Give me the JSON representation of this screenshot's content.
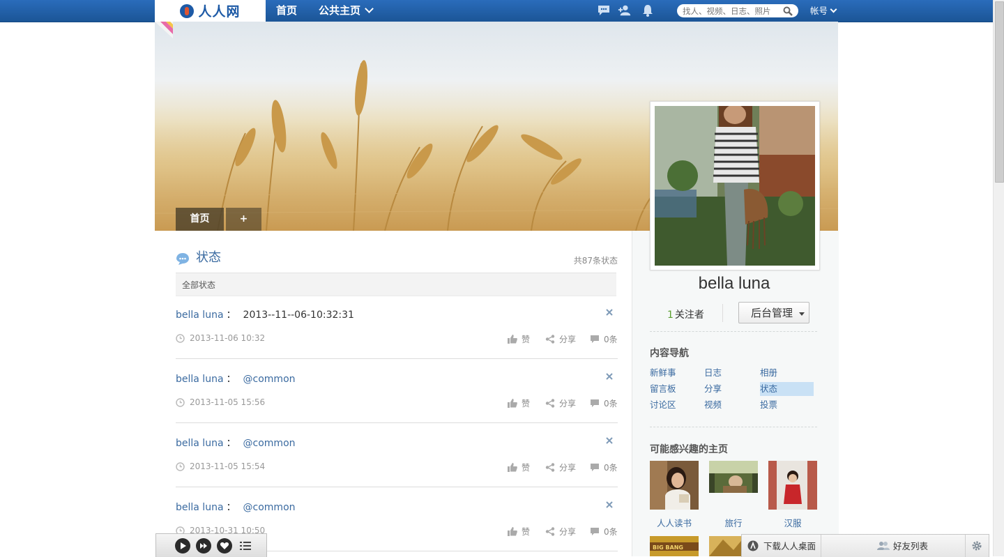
{
  "topbar": {
    "logo_text": "人人网",
    "nav_home": "首页",
    "nav_public": "公共主页",
    "search_placeholder": "找人、视频、日志、照片",
    "account_label": "帐号"
  },
  "cover": {
    "tabs": [
      "首页",
      "+"
    ]
  },
  "status_section": {
    "title": "状态",
    "count_text": "共87条状态",
    "filter_label": "全部状态",
    "items": [
      {
        "author": "bella luna",
        "text": "2013--11--06-10:32:31",
        "text_is_link": false,
        "time": "2013-11-06 10:32",
        "like": "赞",
        "share": "分享",
        "comments": "0条"
      },
      {
        "author": "bella luna",
        "text": "@common",
        "text_is_link": true,
        "time": "2013-11-05 15:56",
        "like": "赞",
        "share": "分享",
        "comments": "0条"
      },
      {
        "author": "bella luna",
        "text": "@common",
        "text_is_link": true,
        "time": "2013-11-05 15:54",
        "like": "赞",
        "share": "分享",
        "comments": "0条"
      },
      {
        "author": "bella luna",
        "text": "@common",
        "text_is_link": true,
        "time": "2013-10-31 10:50",
        "like": "赞",
        "share": "分享",
        "comments": "0条"
      }
    ]
  },
  "profile": {
    "name": "bella luna",
    "followers_count": "1",
    "followers_label": "关注者",
    "admin_button": "后台管理"
  },
  "content_nav": {
    "title": "内容导航",
    "items": [
      "新鲜事",
      "日志",
      "相册",
      "留言板",
      "分享",
      "状态",
      "讨论区",
      "视频",
      "投票"
    ],
    "active": "状态"
  },
  "recommend": {
    "title": "可能感兴趣的主页",
    "items": [
      "人人读书",
      "旅行",
      "汉服"
    ]
  },
  "bottom_bar": {
    "download": "下载人人桌面",
    "friends": "好友列表"
  },
  "colors": {
    "topbar": "#1e5fa8",
    "link": "#3a6aa0",
    "follower_num": "#5a9e2f",
    "nav_active_bg": "#c9e1f5"
  }
}
